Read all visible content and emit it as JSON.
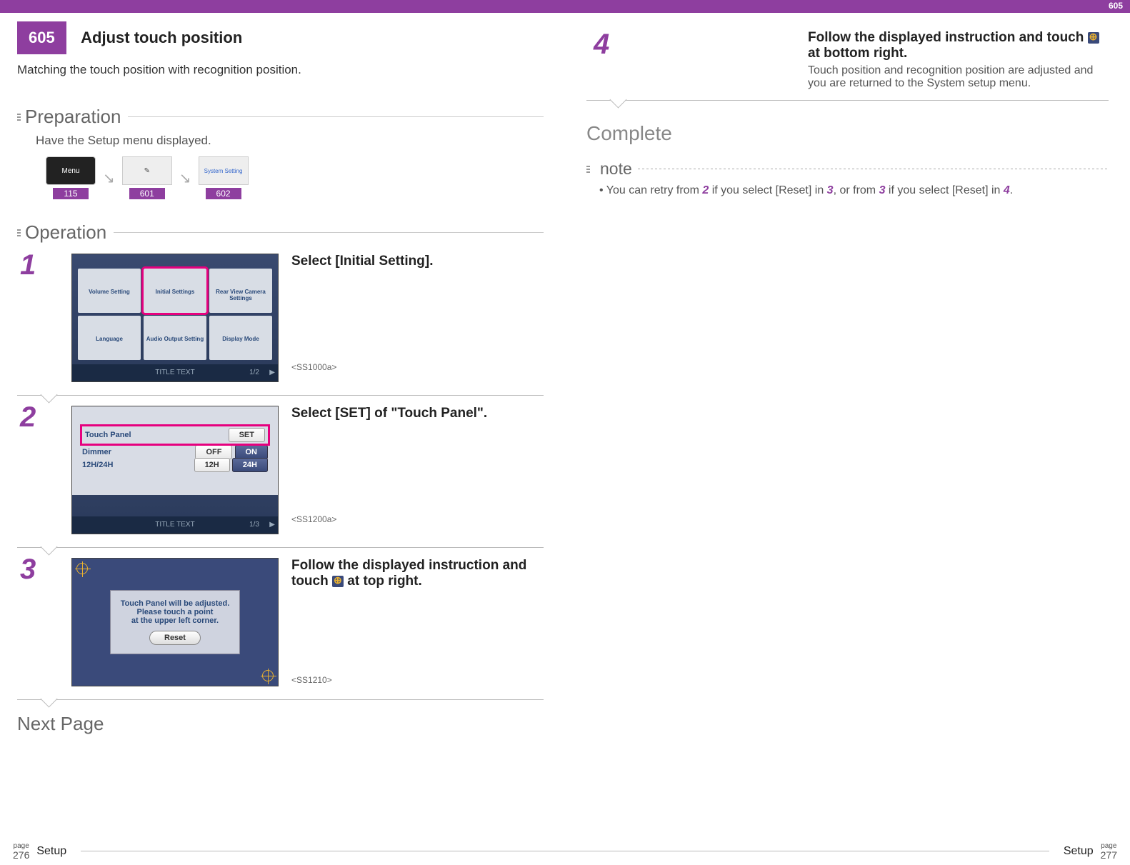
{
  "header": {
    "section_number": "605",
    "title": "Adjust touch position",
    "top_right": "605"
  },
  "intro": "Matching the touch position with recognition position.",
  "preparation": {
    "heading": "Preparation",
    "text": "Have the Setup menu displayed.",
    "items": [
      {
        "label": "Menu",
        "ref": "115"
      },
      {
        "label": "",
        "ref": "601"
      },
      {
        "label": "System Setting",
        "ref": "602"
      }
    ]
  },
  "operation": {
    "heading": "Operation"
  },
  "steps": {
    "s1": {
      "num": "1",
      "title": "Select [Initial Setting].",
      "code": "<SS1000a>",
      "screen": {
        "tiles": [
          "Volume Setting",
          "Initial Settings",
          "Rear View Camera Settings",
          "Language",
          "Audio Output Setting",
          "Display Mode"
        ],
        "footer": "TITLE TEXT",
        "page": "1/2"
      }
    },
    "s2": {
      "num": "2",
      "title": "Select [SET] of \"Touch Panel\".",
      "code": "<SS1200a>",
      "screen": {
        "rows": [
          {
            "label": "Touch Panel",
            "btn": "SET",
            "hl": true
          },
          {
            "label": "Dimmer",
            "b1": "OFF",
            "b2": "ON"
          },
          {
            "label": "12H/24H",
            "b1": "12H",
            "b2": "24H"
          }
        ],
        "footer": "TITLE TEXT",
        "page": "1/3"
      }
    },
    "s3": {
      "num": "3",
      "title_a": "Follow the displayed instruction and touch ",
      "title_b": " at top right.",
      "code": "<SS1210>",
      "screen": {
        "line1": "Touch Panel will be adjusted.",
        "line2": "Please touch a point",
        "line3": "at the upper left corner.",
        "reset": "Reset"
      }
    },
    "s4": {
      "num": "4",
      "title_a": "Follow the displayed instruction and touch ",
      "title_b": " at bottom right.",
      "sub": "Touch position and recognition position are adjusted and you are returned to the System setup menu."
    }
  },
  "complete": "Complete",
  "note": {
    "heading": "note",
    "prefix": "• You can retry from ",
    "n2": "2",
    "t1": " if you select [Reset] in ",
    "n3a": "3",
    "t2": ", or from ",
    "n3b": "3",
    "t3": " if you select [Reset] in ",
    "n4": "4",
    "t4": "."
  },
  "next_page": "Next Page",
  "footer": {
    "page_word": "page",
    "left_num": "276",
    "right_num": "277",
    "setup": "Setup"
  }
}
